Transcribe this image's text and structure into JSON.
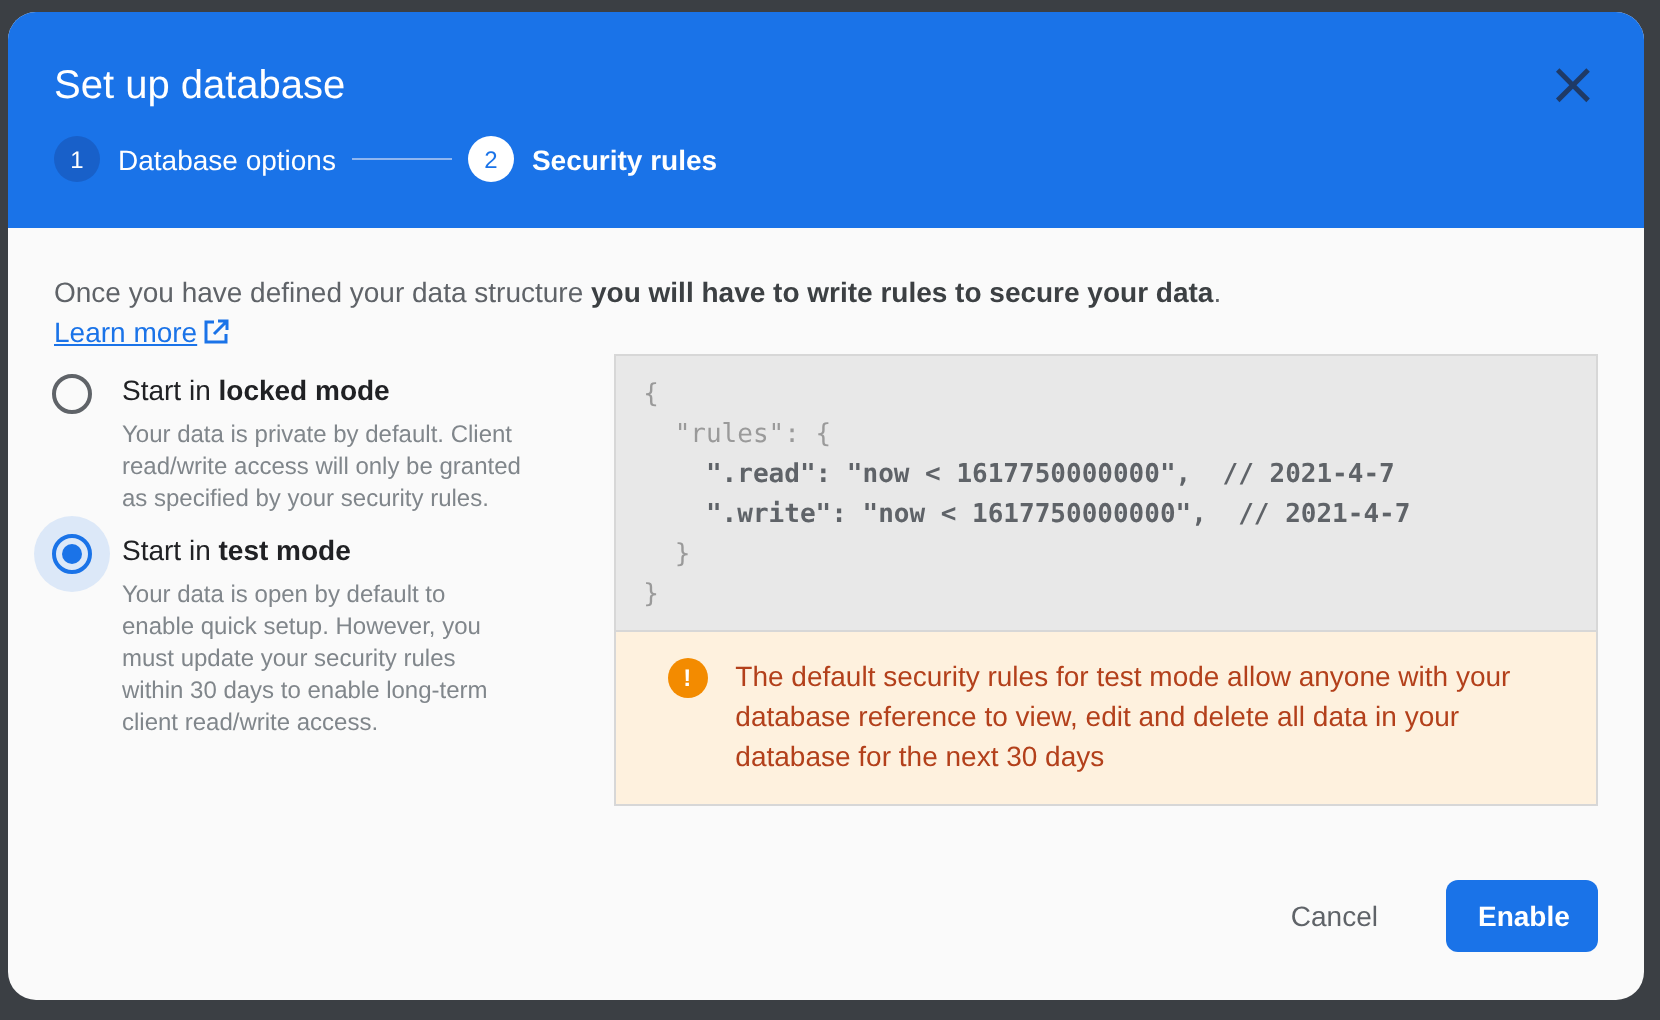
{
  "dialog": {
    "title": "Set up database",
    "close": "×"
  },
  "steps": [
    {
      "number": "1",
      "label": "Database options",
      "selected": false
    },
    {
      "number": "2",
      "label": "Security rules",
      "selected": true
    }
  ],
  "intro": "Once you have defined your data structure **you will have to write rules to secure your data**.",
  "learn_more": "Learn more",
  "options": [
    {
      "label": "Start in **locked mode**",
      "description": "Your data is private by default. Client read/write access will only be granted as specified by your security rules.",
      "selected": false
    },
    {
      "label": "Start in **test mode**",
      "description": "Your data is open by default to enable quick setup. However, you must update your security rules within 30 days to enable long-term client read/write access.",
      "selected": true
    }
  ],
  "code_lines": [
    {
      "text": "{",
      "emphasis": false
    },
    {
      "text": "  \"rules\": {",
      "emphasis": false
    },
    {
      "text": "    \".read\": \"now < 1617750000000\",  // 2021-4-7",
      "emphasis": true
    },
    {
      "text": "    \".write\": \"now < 1617750000000\",  // 2021-4-7",
      "emphasis": true
    },
    {
      "text": "  }",
      "emphasis": false
    },
    {
      "text": "}",
      "emphasis": false
    }
  ],
  "warning": {
    "icon": "!",
    "text": "The default security rules for test mode allow anyone with your database reference to view, edit and delete all data in your database for the next 30 days"
  },
  "buttons": [
    {
      "label": "Cancel",
      "kind": "text"
    },
    {
      "label": "Enable",
      "kind": "primary"
    }
  ]
}
